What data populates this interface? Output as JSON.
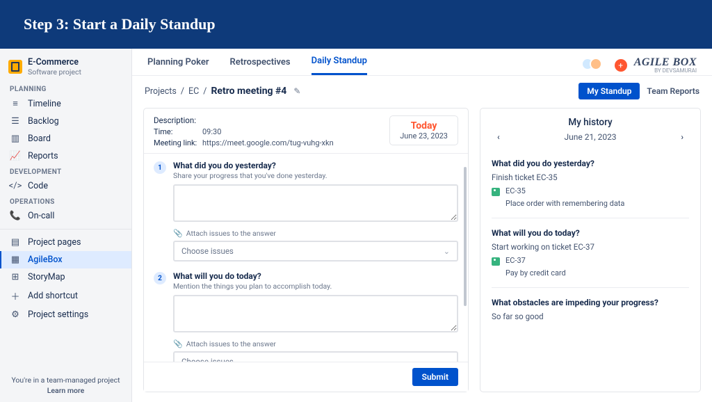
{
  "banner": {
    "title": "Step 3: Start a Daily Standup"
  },
  "project": {
    "name": "E-Commerce",
    "type": "Software project"
  },
  "sidebar": {
    "planning_label": "PLANNING",
    "planning": [
      "Timeline",
      "Backlog",
      "Board",
      "Reports"
    ],
    "dev_label": "DEVELOPMENT",
    "dev": [
      "Code"
    ],
    "ops_label": "OPERATIONS",
    "ops": [
      "On-call"
    ],
    "extras": [
      "Project pages",
      "AgileBox",
      "StoryMap",
      "Add shortcut",
      "Project settings"
    ],
    "footer_line": "You're in a team-managed project",
    "footer_link": "Learn more"
  },
  "tabs": [
    "Planning Poker",
    "Retrospectives",
    "Daily Standup"
  ],
  "brand": {
    "name": "AGILE BOX",
    "by": "BY DEVSAMURAI"
  },
  "breadcrumb": {
    "p": "Projects",
    "s": "EC",
    "title": "Retro meeting #4"
  },
  "subbar": {
    "my_standup": "My Standup",
    "team_reports": "Team Reports"
  },
  "meeting": {
    "desc_label": "Description:",
    "time_label": "Time:",
    "time": "09:30",
    "link_label": "Meeting link:",
    "link": "https://meet.google.com/tug-vuhg-xkn",
    "today": "Today",
    "date": "June 23, 2023"
  },
  "questions": {
    "q1": {
      "title": "What did you do yesterday?",
      "sub": "Share your progress that you've done yesterday."
    },
    "q2": {
      "title": "What will you do today?",
      "sub": "Mention the things you plan to accomplish today."
    },
    "attach_label": "Attach issues to the answer",
    "choose": "Choose issues"
  },
  "submit_label": "Submit",
  "history": {
    "title": "My history",
    "date": "June 21, 2023",
    "q1": "What did you do yesterday?",
    "a1": "Finish ticket EC-35",
    "t1_id": "EC-35",
    "t1_desc": "Place order with remembering data",
    "q2": "What will you do today?",
    "a2": "Start working on ticket EC-37",
    "t2_id": "EC-37",
    "t2_desc": "Pay by credit card",
    "q3": "What obstacles are impeding your progress?",
    "a3": "So far so good"
  }
}
